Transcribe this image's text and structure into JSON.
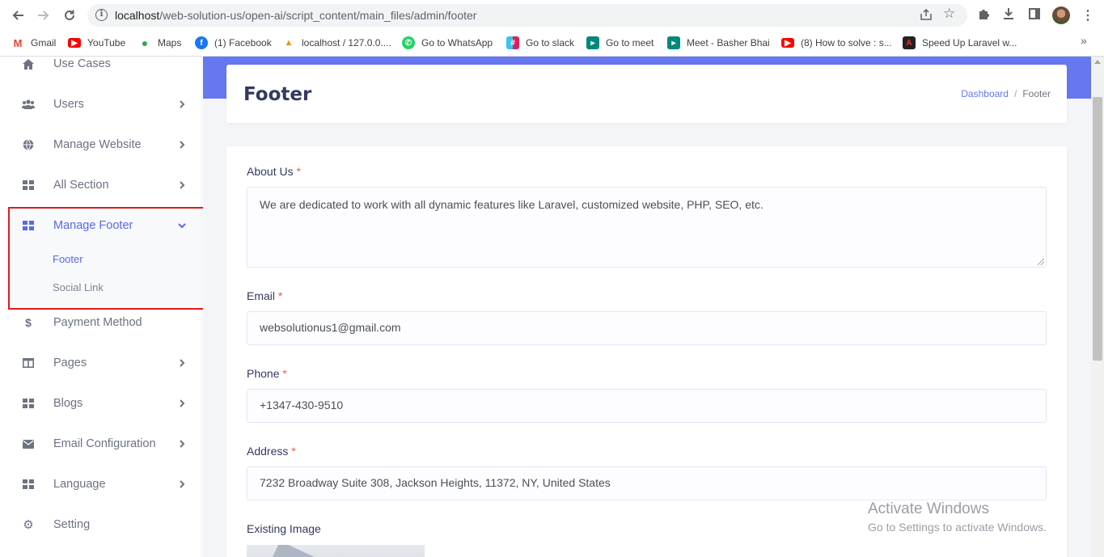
{
  "browser": {
    "url_host": "localhost",
    "url_path": "/web-solution-us/open-ai/script_content/main_files/admin/footer",
    "bookmarks": [
      {
        "label": "Gmail",
        "icon": "gmail-icon",
        "color": "#ea4335"
      },
      {
        "label": "YouTube",
        "icon": "youtube-icon",
        "color": "#ff0000"
      },
      {
        "label": "Maps",
        "icon": "maps-icon",
        "color": "#34a853"
      },
      {
        "label": "(1) Facebook",
        "icon": "facebook-icon",
        "color": "#1877f2"
      },
      {
        "label": "localhost / 127.0.0....",
        "icon": "phpmyadmin-icon",
        "color": "#f29111"
      },
      {
        "label": "Go to WhatsApp",
        "icon": "whatsapp-icon",
        "color": "#25d366"
      },
      {
        "label": "Go to slack",
        "icon": "slack-icon",
        "color": "#e01e5a"
      },
      {
        "label": "Go to meet",
        "icon": "meet-icon",
        "color": "#00897b"
      },
      {
        "label": "Meet - Basher Bhai",
        "icon": "meet-icon",
        "color": "#00897b"
      },
      {
        "label": "(8) How to solve : s...",
        "icon": "youtube-icon",
        "color": "#ff0000"
      },
      {
        "label": "Speed Up Laravel w...",
        "icon": "laravel-icon",
        "color": "#222222"
      }
    ]
  },
  "sidebar": {
    "items": [
      {
        "label": "Use Cases",
        "icon": "home-icon",
        "chevron": false
      },
      {
        "label": "Users",
        "icon": "users-icon",
        "chevron": true
      },
      {
        "label": "Manage Website",
        "icon": "globe-icon",
        "chevron": true
      },
      {
        "label": "All Section",
        "icon": "grid-icon",
        "chevron": true
      },
      {
        "label": "Manage Footer",
        "icon": "grid-icon",
        "chevron": true,
        "active": true
      },
      {
        "label": "Payment Method",
        "icon": "dollar-icon",
        "chevron": false
      },
      {
        "label": "Pages",
        "icon": "columns-icon",
        "chevron": true
      },
      {
        "label": "Blogs",
        "icon": "grid-icon",
        "chevron": true
      },
      {
        "label": "Email Configuration",
        "icon": "envelope-icon",
        "chevron": true
      },
      {
        "label": "Language",
        "icon": "grid-icon",
        "chevron": true
      },
      {
        "label": "Setting",
        "icon": "gear-icon",
        "chevron": false
      }
    ],
    "submenu": {
      "footer": "Footer",
      "social_link": "Social Link"
    }
  },
  "header": {
    "title": "Footer",
    "breadcrumb_dashboard": "Dashboard",
    "breadcrumb_separator": "/",
    "breadcrumb_current": "Footer"
  },
  "form": {
    "required_mark": "*",
    "about_label": "About Us",
    "about_value": "We are dedicated to work with all dynamic features like Laravel, customized website, PHP, SEO, etc.",
    "email_label": "Email",
    "email_value": "websolutionus1@gmail.com",
    "phone_label": "Phone",
    "phone_value": "+1347-430-9510",
    "address_label": "Address",
    "address_value": "7232 Broadway Suite 308, Jackson Heights, 11372, NY, United States",
    "image_label": "Existing Image"
  },
  "watermark": {
    "line1": "Activate Windows",
    "line2": "Go to Settings to activate Windows."
  },
  "colors": {
    "accent": "#6777ef",
    "active_text": "#5969e6",
    "highlight_border": "#e01b1b",
    "required": "#fc544b"
  }
}
